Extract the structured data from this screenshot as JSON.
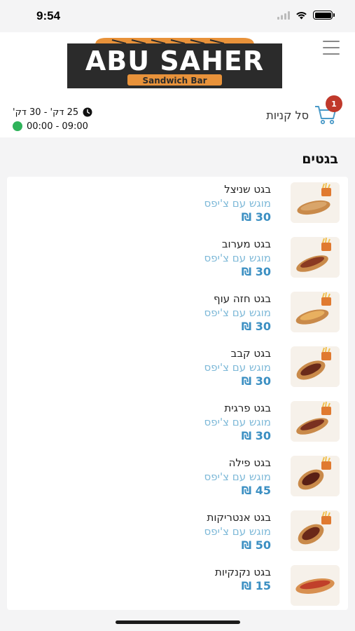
{
  "status_bar": {
    "time": "9:54"
  },
  "header": {
    "logo": {
      "brand": "ABU SAHER",
      "tagline": "Sandwich Bar",
      "colors": {
        "bg": "#2b2b2b",
        "accent": "#e8923a",
        "text": "#ffffff"
      }
    },
    "menu_icon": "hamburger-menu-icon",
    "delivery_time": "25 דק' - 30 דק'",
    "opening_hours": "00:00 - 09:00",
    "cart": {
      "label": "סל קניות",
      "count": "1",
      "icon": "shopping-cart-icon",
      "badge_color": "#c0392b"
    }
  },
  "section": {
    "title": "בגטים"
  },
  "items": [
    {
      "name": "בגט שניצל",
      "desc": "מוגש עם צ'יפס",
      "price": "30 ₪"
    },
    {
      "name": "בגט מערוב",
      "desc": "מוגש עם צ'יפס",
      "price": "30 ₪"
    },
    {
      "name": "בגט חזה עוף",
      "desc": "מוגש עם צ'יפס",
      "price": "30 ₪"
    },
    {
      "name": "בגט קבב",
      "desc": "מוגש עם צ'יפס",
      "price": "30 ₪"
    },
    {
      "name": "בגט פרגית",
      "desc": "מוגש עם צ'יפס",
      "price": "30 ₪"
    },
    {
      "name": "בגט פילה",
      "desc": "מוגש עם צ'יפס",
      "price": "45 ₪"
    },
    {
      "name": "בגט אנטריקות",
      "desc": "מוגש עם צ'יפס",
      "price": "50 ₪"
    },
    {
      "name": "בגט נקנקיות",
      "desc": "",
      "price": "15 ₪"
    }
  ],
  "colors": {
    "price": "#3b8fc2",
    "description": "#7eb9d8",
    "open_status": "#2fb35a"
  }
}
